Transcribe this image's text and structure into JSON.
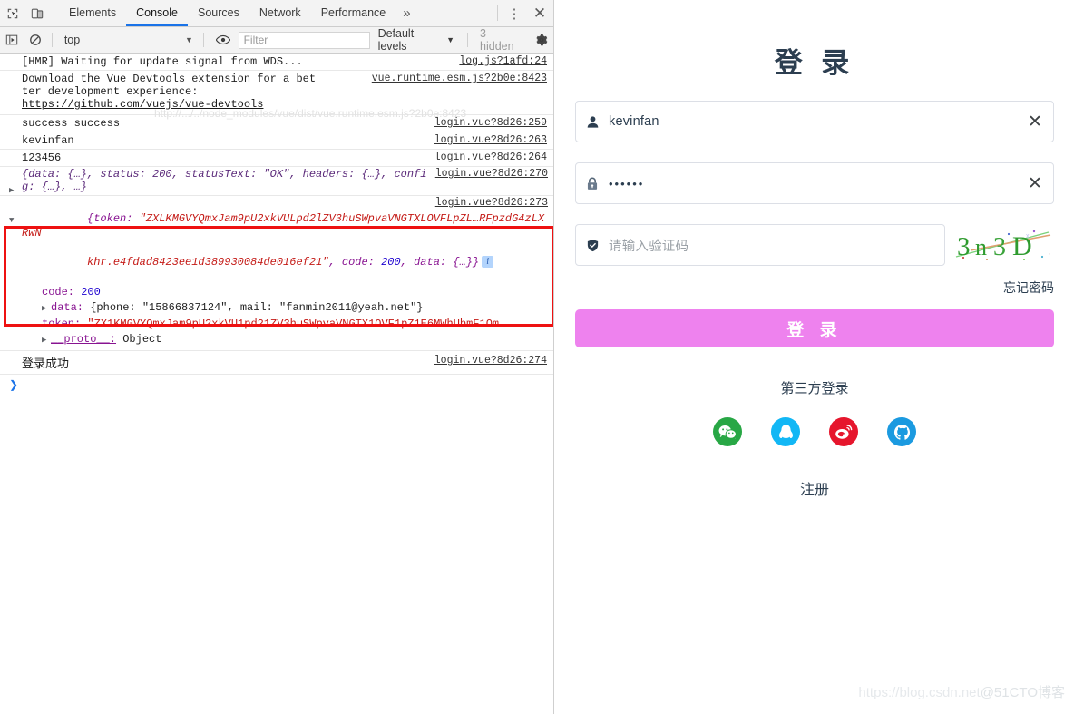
{
  "devtools": {
    "tabs": [
      {
        "label": "Elements",
        "active": false
      },
      {
        "label": "Console",
        "active": true
      },
      {
        "label": "Sources",
        "active": false
      },
      {
        "label": "Network",
        "active": false
      },
      {
        "label": "Performance",
        "active": false
      }
    ],
    "more_label": "»",
    "kebab_label": "⋮",
    "close_label": "✕",
    "icons": {
      "inspect": "inspect-element-icon",
      "device": "device-toolbar-icon",
      "sidebar": "console-sidebar-icon",
      "clear": "clear-console-icon",
      "eye": "live-expression-icon",
      "gear": "settings-gear-icon"
    },
    "filterbar": {
      "context": "top",
      "context_caret": "▼",
      "filter_placeholder": "Filter",
      "filter_value": "",
      "levels": "Default levels",
      "levels_caret": "▼",
      "hidden": "3 hidden"
    },
    "console_rows": [
      {
        "id": "hmr",
        "text": "[HMR] Waiting for update signal from WDS...",
        "source": "log.js?1afd:24"
      },
      {
        "id": "vue-devtools",
        "text": "Download the Vue Devtools extension for a better development experience:",
        "link": "https://github.com/vuejs/vue-devtools",
        "source": "vue.runtime.esm.js?2b0e:8423",
        "ghost": "http://.../../node_modules/vue/dist/vue.runtime.esm.js?2b0e:8423"
      },
      {
        "id": "success",
        "text": "success success",
        "source": "login.vue?8d26:259"
      },
      {
        "id": "username-log",
        "text": "kevinfan",
        "source": "login.vue?8d26:263"
      },
      {
        "id": "password-log",
        "text": "123456",
        "source": "login.vue?8d26:264"
      },
      {
        "id": "response-object",
        "source": "login.vue?8d26:270",
        "preview": "{data: {…}, status: 200, statusText: \"OK\", headers: {…}, config: {…}, …}"
      }
    ],
    "highlighted": {
      "source": "login.vue?8d26:273",
      "line1_a": "{token: ",
      "line1_token": "\"ZXLKMGVYQmxJam9pU2xkVULpd2lZV3huSWpvaVNGTXLOVFLpZL…RFpzdG4zLXRwN",
      "line2_token": "khr.e4fdad8423ee1d389930084de016ef21\"",
      "line2_rest_a": ", code: ",
      "line2_code": "200",
      "line2_rest_b": ", data: {…}}",
      "info_badge": "i",
      "rows": [
        {
          "key": "code:",
          "value": "200",
          "vtype": "num",
          "expandable": false
        },
        {
          "key": "data:",
          "value": "{phone: \"15866837124\", mail: \"fanmin2011@yeah.net\"}",
          "vtype": "obj",
          "expandable": true
        },
        {
          "key": "token:",
          "value": "\"ZX1KMGVYQmxJam9pU2xkVU1pd21ZV3huSWpvaVNGTX1OVF1pZ1E6MWhUbmF1Om…",
          "vtype": "str",
          "expandable": false
        },
        {
          "key": "__proto__:",
          "value": "Object",
          "vtype": "plain",
          "expandable": true
        }
      ]
    },
    "trailing_rows": [
      {
        "id": "login-success",
        "text": "登录成功",
        "source": "login.vue?8d26:274"
      }
    ],
    "prompt_caret": "❯"
  },
  "login_page": {
    "title": "登 录",
    "username": {
      "icon": "user-icon",
      "value": "kevinfan",
      "clear": "✕"
    },
    "password": {
      "icon": "lock-icon",
      "value": "••••••",
      "clear": "✕"
    },
    "captcha": {
      "icon": "shield-check-icon",
      "placeholder": "请输入验证码",
      "value": "",
      "image_text": "3n3D"
    },
    "forgot_password": "忘记密码",
    "login_button": "登 录",
    "third_party_label": "第三方登录",
    "socials": [
      {
        "name": "wechat",
        "color": "#28a745"
      },
      {
        "name": "qq",
        "color": "#12b7f5"
      },
      {
        "name": "weibo",
        "color": "#e6162d"
      },
      {
        "name": "github",
        "color": "#1b9ae0"
      }
    ],
    "register": "注册",
    "watermark_1": "https://blog.csdn.net",
    "watermark_2": "@51CTO博客"
  },
  "colors": {
    "accent_tab": "#1a73e8",
    "login_button": "#ee82ee",
    "annotation_red": "#ee1111",
    "string_red": "#c41a16",
    "number_blue": "#1c00cf",
    "key_purple": "#881391"
  }
}
